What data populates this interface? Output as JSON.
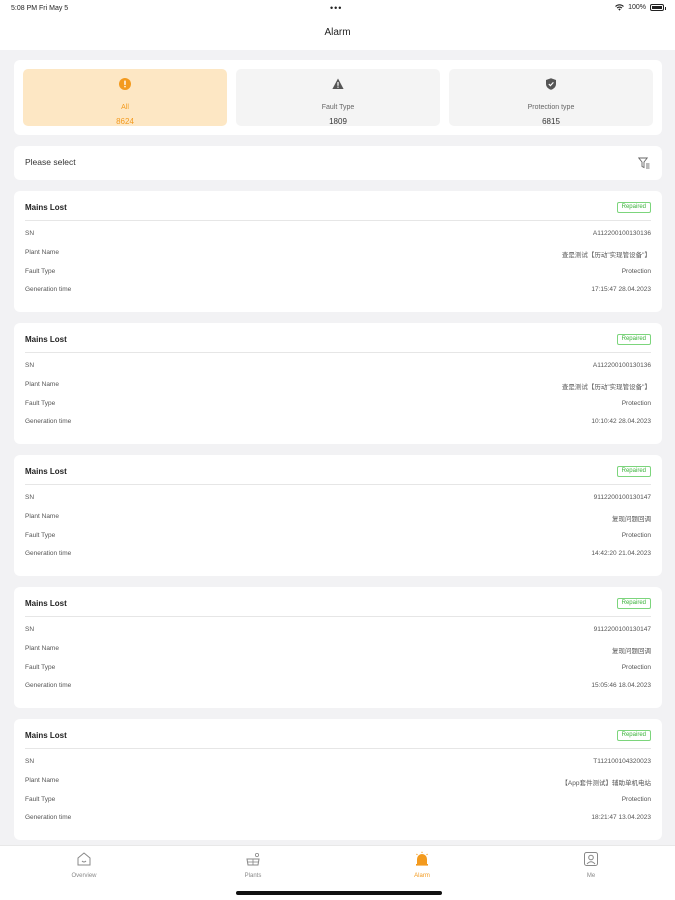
{
  "status_bar": {
    "time": "5:08 PM  Fri May 5",
    "dots": "•••",
    "battery": "100%"
  },
  "header": {
    "title": "Alarm"
  },
  "stats": [
    {
      "label": "All",
      "count": "8624",
      "icon": "alert-circle-icon",
      "active": true
    },
    {
      "label": "Fault Type",
      "count": "1809",
      "icon": "warning-triangle-icon",
      "active": false
    },
    {
      "label": "Protection type",
      "count": "6815",
      "icon": "shield-icon",
      "active": false
    }
  ],
  "filter": {
    "placeholder": "Please select",
    "icon": "filter-icon"
  },
  "field_labels": {
    "sn": "SN",
    "plant_name": "Plant Name",
    "fault_type": "Fault Type",
    "generation_time": "Generation time"
  },
  "alarms": [
    {
      "title": "Mains Lost",
      "status": "Repaired",
      "sn": "A11220010013013​6",
      "plant_name": "查是测试【历动\"实现管设备\"】",
      "fault_type": "Protection",
      "generation_time": "17:15:47 28.04.2023"
    },
    {
      "title": "Mains Lost",
      "status": "Repaired",
      "sn": "A11220010013013​6",
      "plant_name": "查是测试【历动\"实现管设备\"】",
      "fault_type": "Protection",
      "generation_time": "10:10:42 28.04.2023"
    },
    {
      "title": "Mains Lost",
      "status": "Repaired",
      "sn": "911220010013014​7",
      "plant_name": "复现问题回调",
      "fault_type": "Protection",
      "generation_time": "14:42:20 21.04.2023"
    },
    {
      "title": "Mains Lost",
      "status": "Repaired",
      "sn": "911220010013014​7",
      "plant_name": "复现问题回调",
      "fault_type": "Protection",
      "generation_time": "15:05:46 18.04.2023"
    },
    {
      "title": "Mains Lost",
      "status": "Repaired",
      "sn": "T11210010432002​3",
      "plant_name": "【App套件测试】辅助单机电站",
      "fault_type": "Protection",
      "generation_time": "18:21:47 13.04.2023"
    }
  ],
  "tabs": [
    {
      "label": "Overview",
      "icon": "home-icon",
      "active": false
    },
    {
      "label": "Plants",
      "icon": "solar-plant-icon",
      "active": false
    },
    {
      "label": "Alarm",
      "icon": "bell-icon",
      "active": true
    },
    {
      "label": "Me",
      "icon": "user-icon",
      "active": false
    }
  ],
  "colors": {
    "accent": "#f39a1e",
    "accent_bg": "#fde7c4",
    "repaired": "#3bb33b",
    "background": "#f2f2f4"
  }
}
